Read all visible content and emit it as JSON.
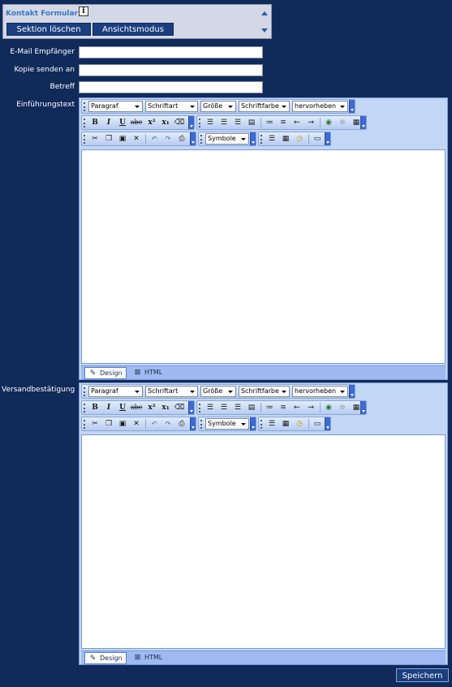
{
  "section": {
    "title": "Kontakt Formular",
    "info_icon": "info-icon",
    "delete_label": "Sektion löschen",
    "view_label": "Ansichtsmodus"
  },
  "fields": {
    "email_label": "E-Mail Empfänger",
    "copy_label": "Kopie senden an",
    "subject_label": "Betreff",
    "email_value": "",
    "copy_value": "",
    "subject_value": ""
  },
  "editors": [
    {
      "label": "Einführungstext"
    },
    {
      "label": "Versandbestätigung"
    }
  ],
  "toolbar": {
    "paragraph": "Paragraf",
    "font": "Schriftart",
    "size": "Größe",
    "font_color": "Schriftfarbe",
    "highlight": "hervorheben",
    "symbols": "Symbole",
    "bold": "B",
    "italic": "I",
    "underline": "U",
    "strike": "abc",
    "superscript": "x²",
    "subscript": "x₁"
  },
  "modes": {
    "design": "Design",
    "html": "HTML"
  },
  "save_label": "Speichern",
  "colors": {
    "background": "#102a5a",
    "toolbar": "#c2d6f5",
    "button": "#1a3e7e"
  }
}
